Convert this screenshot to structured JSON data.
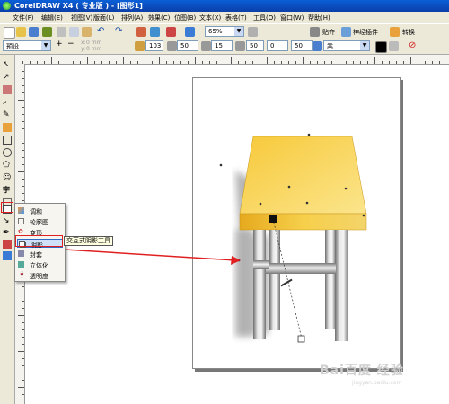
{
  "window": {
    "title": "CorelDRAW X4 ( 专业版 ) - [图形1]"
  },
  "menu": [
    "文件(F)",
    "编辑(E)",
    "视图(V)",
    "版面(L)",
    "排列(A)",
    "效果(C)",
    "位图(B)",
    "文本(X)",
    "表格(T)",
    "工具(O)",
    "窗口(W)",
    "帮助(H)"
  ],
  "toolbar1": {
    "zoom": "65%",
    "snap_label": "贴齐",
    "plugin_label": "神经插件",
    "convert_label": "转换"
  },
  "toolbar2": {
    "preset": "预设...",
    "x_value": "0 mm",
    "y_value": "0 mm",
    "opacity": "103",
    "feather_dir": "50",
    "feather": "15",
    "fade": "50",
    "stretch": "0",
    "x_offset": "50",
    "color_mode": "乘",
    "shadow_color": "#000000"
  },
  "flyout": {
    "items": [
      "调和",
      "轮廓图",
      "变形",
      "阴影",
      "封套",
      "立体化",
      "透明度"
    ],
    "selected": "阴影"
  },
  "tooltip": "交互式阴影工具",
  "watermark": {
    "main": "Bai百度 经验",
    "sub": "jingyan.baidu.com"
  }
}
